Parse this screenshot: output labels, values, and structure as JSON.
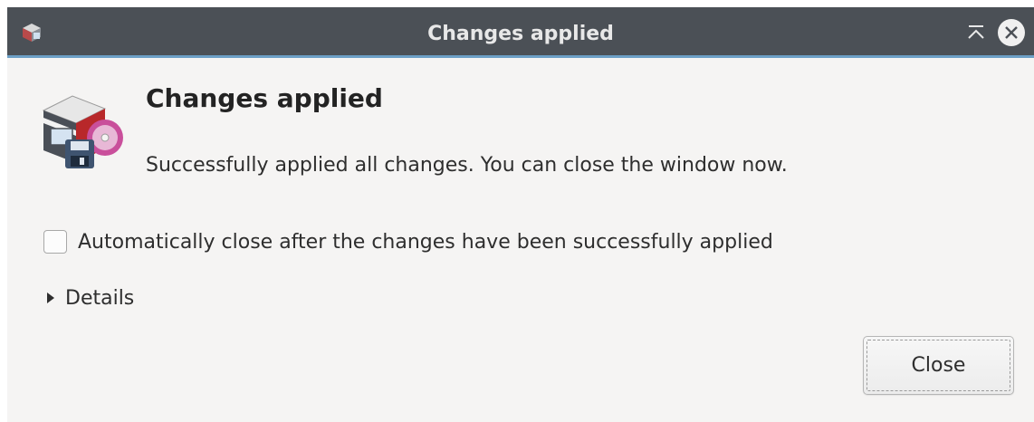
{
  "window": {
    "title": "Changes applied",
    "app_icon": "package-manager-icon",
    "controls": {
      "keep_above_icon": "keep-above-icon",
      "close_icon": "window-close-icon"
    }
  },
  "dialog": {
    "icon": "software-install-icon",
    "heading": "Changes applied",
    "message": "Successfully applied all changes. You can close the window now.",
    "auto_close": {
      "label": "Automatically close after the changes have been successfully applied",
      "checked": false
    },
    "details": {
      "label": "Details",
      "expanded": false
    },
    "close_button_label": "Close"
  },
  "colors": {
    "titlebar": "#4b5056",
    "titlebar_accent": "#6c9fc6",
    "background": "#f5f4f3"
  }
}
